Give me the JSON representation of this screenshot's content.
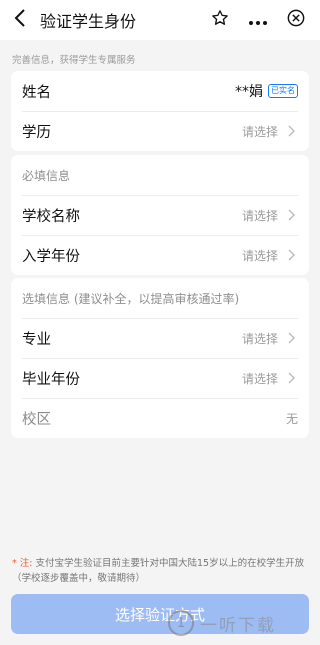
{
  "nav": {
    "title": "验证学生身份",
    "icons": [
      "back-arrow-icon",
      "star-icon",
      "more-icon",
      "close-circle-icon"
    ]
  },
  "hint": "完善信息，获得学生专属服务",
  "basic": {
    "name_label": "姓名",
    "name_value": "**娟",
    "verified_badge": "已实名",
    "edu_label": "学历",
    "edu_value": "请选择"
  },
  "required": {
    "section_label": "必填信息",
    "school_label": "学校名称",
    "school_value": "请选择",
    "year_label": "入学年份",
    "year_value": "请选择"
  },
  "optional": {
    "section_label": "选填信息 (建议补全，以提高审核通过率)",
    "major_label": "专业",
    "major_value": "请选择",
    "grad_label": "毕业年份",
    "grad_value": "请选择",
    "campus_label": "校区",
    "campus_value": "无"
  },
  "notice": {
    "star": "* 注:",
    "text": "支付宝学生验证目前主要针对中国大陆15岁以上的在校学生开放（学校逐步覆盖中，敬请期待）"
  },
  "button": {
    "label": "选择验证方式"
  },
  "watermark": {
    "logo_char": "1",
    "text": "一听下载"
  }
}
